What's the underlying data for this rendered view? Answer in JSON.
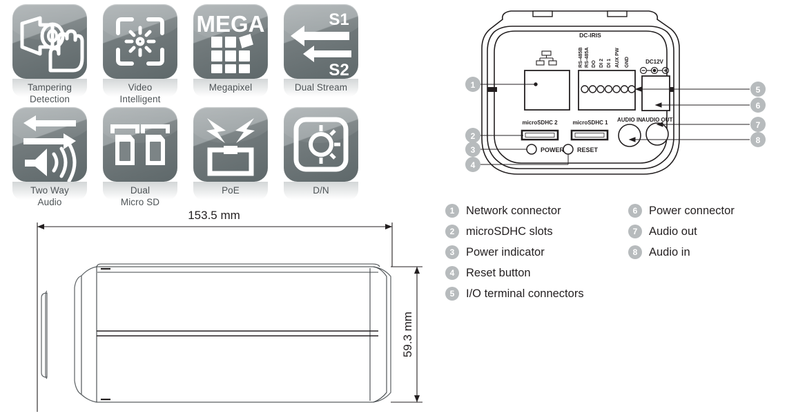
{
  "features": [
    {
      "icon": "tampering-detection-icon",
      "label": "Tampering\nDetection",
      "line1": "Tampering",
      "line2": "Detection"
    },
    {
      "icon": "video-intelligent-icon",
      "label": "Video\nIntelligent",
      "line1": "Video",
      "line2": "Intelligent"
    },
    {
      "icon": "megapixel-icon",
      "label": "Megapixel",
      "line1": "Megapixel",
      "line2": "",
      "tile_text": "MEGA"
    },
    {
      "icon": "dual-stream-icon",
      "label": "Dual Stream",
      "line1": "Dual Stream",
      "line2": "",
      "tile_text_1": "S1",
      "tile_text_2": "S2"
    },
    {
      "icon": "two-way-audio-icon",
      "label": "Two Way\nAudio",
      "line1": "Two Way",
      "line2": "Audio"
    },
    {
      "icon": "dual-micro-sd-icon",
      "label": "Dual\nMicro SD",
      "line1": "Dual",
      "line2": "Micro SD"
    },
    {
      "icon": "poe-icon",
      "label": "PoE",
      "line1": "PoE",
      "line2": ""
    },
    {
      "icon": "day-night-icon",
      "label": "D/N",
      "line1": "D/N",
      "line2": ""
    }
  ],
  "dimensions": {
    "width_label": "153.5 mm",
    "height_label": "59.3 mm"
  },
  "rear_panel": {
    "dc_iris_label": "DC-IRIS",
    "dc12v_label": "DC12V",
    "terminal_labels": [
      "RS-485B",
      "RS-485A",
      "DO",
      "DI 2",
      "DI 1",
      "AUX PW",
      "GND"
    ],
    "microsdhc_2_label": "microSDHC 2",
    "microsdhc_1_label": "microSDHC 1",
    "power_label": "POWER",
    "reset_label": "RESET",
    "audio_in_label": "AUDIO IN",
    "audio_out_label": "AUDIO OUT",
    "callouts": [
      "1",
      "2",
      "3",
      "4",
      "5",
      "6",
      "7",
      "8"
    ]
  },
  "legend": {
    "left": [
      {
        "num": "1",
        "text": "Network connector"
      },
      {
        "num": "2",
        "text": "microSDHC slots"
      },
      {
        "num": "3",
        "text": "Power indicator"
      },
      {
        "num": "4",
        "text": "Reset button"
      },
      {
        "num": "5",
        "text": "I/O terminal connectors"
      }
    ],
    "right": [
      {
        "num": "6",
        "text": "Power connector"
      },
      {
        "num": "7",
        "text": "Audio out"
      },
      {
        "num": "8",
        "text": "Audio in"
      }
    ]
  },
  "colors": {
    "tile_light": "#a6acae",
    "tile_dark": "#5e686a",
    "label_text": "#4d5356",
    "badge_gray": "#b7bbbd",
    "line_black": "#231f20"
  }
}
